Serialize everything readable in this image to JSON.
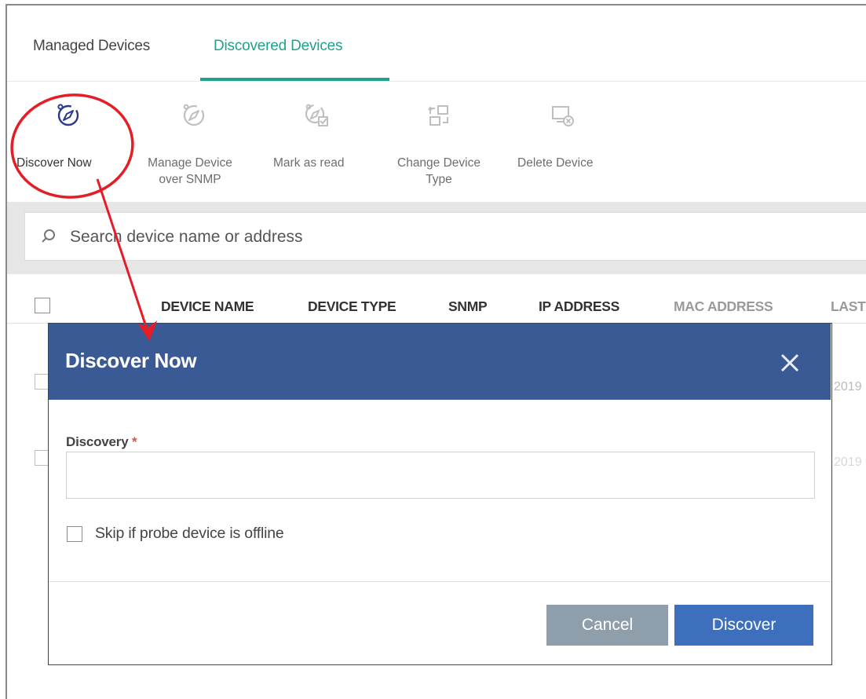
{
  "tabs": [
    {
      "label": "Managed Devices",
      "active": false
    },
    {
      "label": "Discovered Devices",
      "active": true
    }
  ],
  "toolbar": {
    "discover_now": "Discover Now",
    "manage_snmp_line1": "Manage Device",
    "manage_snmp_line2": "over SNMP",
    "mark_read": "Mark as read",
    "change_type_line1": "Change Device",
    "change_type_line2": "Type",
    "delete_device": "Delete Device"
  },
  "search": {
    "placeholder": "Search device name or address",
    "icon": "search-icon"
  },
  "table": {
    "columns": [
      "DEVICE NAME",
      "DEVICE TYPE",
      "SNMP",
      "IP ADDRESS",
      "MAC ADDRESS",
      "LAST"
    ],
    "row_dates": [
      "2019",
      "2019"
    ]
  },
  "modal": {
    "title": "Discover Now",
    "field_label": "Discovery",
    "required_mark": "*",
    "field_value": "",
    "skip_label": "Skip if probe device is offline",
    "skip_checked": false,
    "cancel_label": "Cancel",
    "discover_label": "Discover"
  },
  "colors": {
    "accent": "#21a08b",
    "modal_header": "#3a5a96",
    "discover_button": "#3d6fbd",
    "cancel_button": "#8f9eab",
    "annotation": "#e41e26"
  }
}
